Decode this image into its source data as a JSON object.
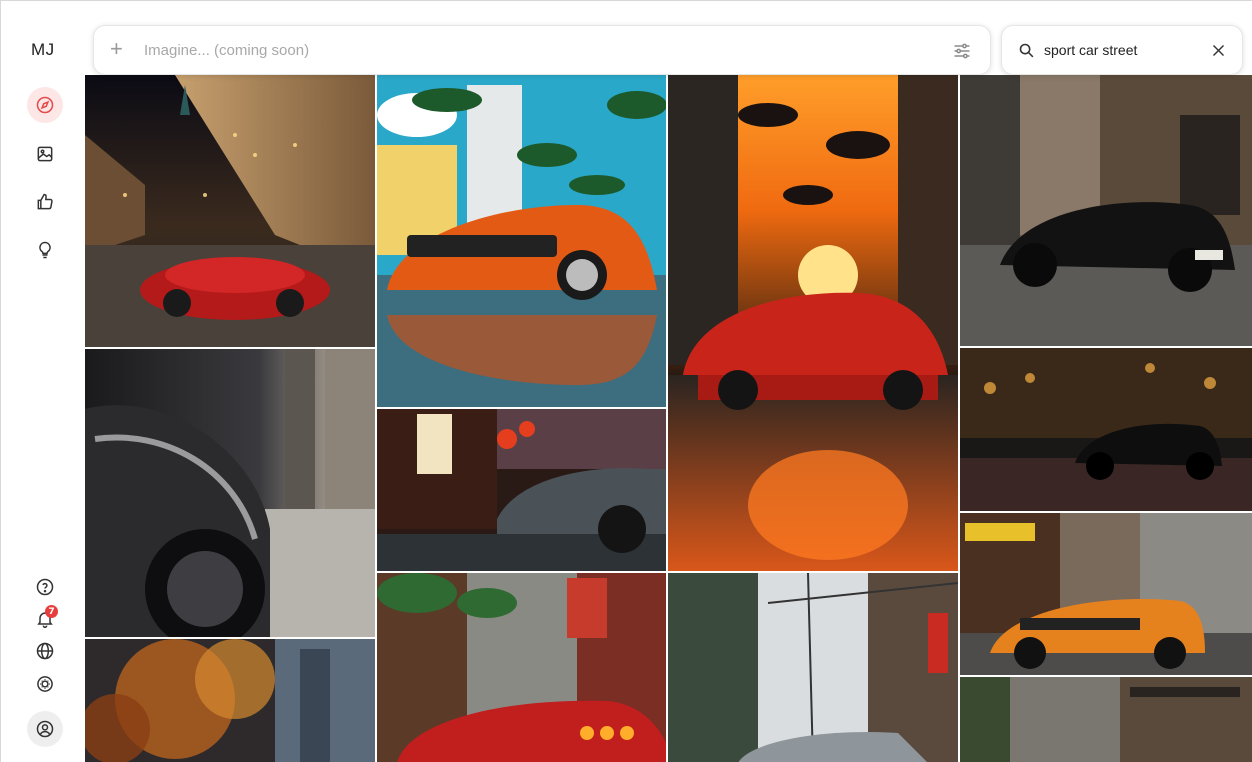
{
  "app": {
    "logo": "MJ"
  },
  "sidebar": {
    "items": [
      {
        "icon": "compass-icon",
        "active": true
      },
      {
        "icon": "image-icon"
      },
      {
        "icon": "thumbs-up-icon"
      },
      {
        "icon": "lightbulb-icon"
      }
    ],
    "bottom": [
      {
        "icon": "help-icon"
      },
      {
        "icon": "bell-icon",
        "badge": "7"
      },
      {
        "icon": "globe-icon"
      },
      {
        "icon": "brightness-icon"
      },
      {
        "icon": "profile-icon"
      }
    ]
  },
  "imagine": {
    "placeholder": "Imagine... (coming soon)"
  },
  "search": {
    "value": "sport car street"
  },
  "colors": {
    "accent": "#e44a4a",
    "badge": "#e83d3d"
  }
}
